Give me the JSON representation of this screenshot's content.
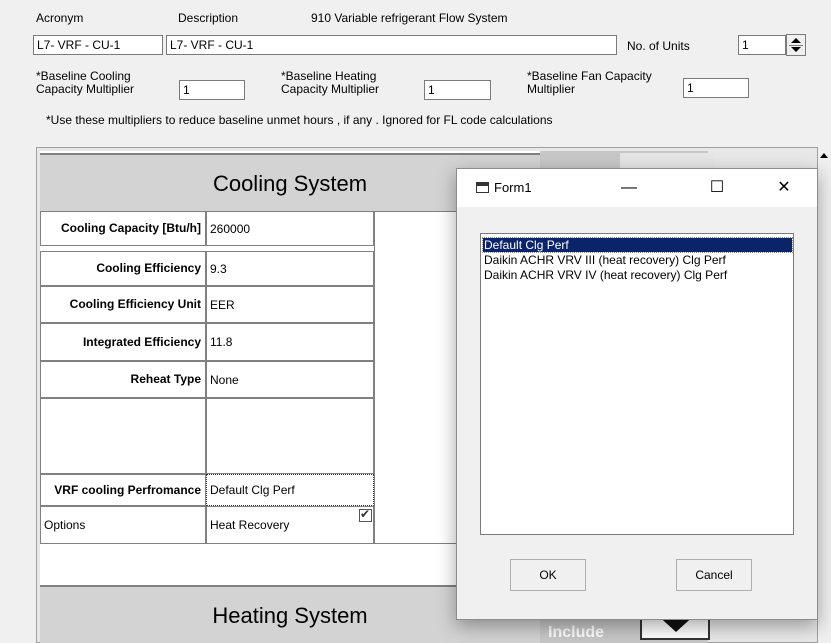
{
  "header": {
    "acronym_label": "Acronym",
    "description_label": "Description",
    "system_type": "910 Variable refrigerant Flow System",
    "acronym_value": "L7- VRF - CU-1",
    "description_value": "L7- VRF - CU-1",
    "units_label": "No. of Units",
    "units_value": "1",
    "cooling_mult_label": "*Baseline Cooling Capacity Multiplier",
    "cooling_mult_value": "1",
    "heating_mult_label": "*Baseline Heating Capacity Multiplier",
    "heating_mult_value": "1",
    "fan_mult_label": "*Baseline Fan Capacity Multiplier",
    "fan_mult_value": "1",
    "note": "*Use these multipliers to reduce baseline unmet hours , if any . Ignored for FL code calculations"
  },
  "cooling": {
    "title": "Cooling System",
    "rows": [
      {
        "label": "Cooling Capacity [Btu/h]",
        "value": "260000"
      },
      {
        "label": "Cooling Efficiency",
        "value": "9.3"
      },
      {
        "label": "Cooling Efficiency Unit",
        "value": "EER"
      },
      {
        "label": "Integrated Efficiency",
        "value": "11.8"
      },
      {
        "label": "Reheat Type",
        "value": "None"
      },
      {
        "label": "",
        "value": ""
      },
      {
        "label": "VRF cooling Perfromance",
        "value": "Default Clg Perf"
      },
      {
        "label": "Options",
        "value": "Heat Recovery"
      }
    ]
  },
  "heating": {
    "title": "Heating System",
    "partial_text": "Include"
  },
  "dialog": {
    "title": "Form1",
    "minimize": "—",
    "maximize": "☐",
    "close": "✕",
    "items": [
      "Default Clg Perf",
      "Daikin ACHR VRV III  (heat recovery) Clg Perf",
      "Daikin ACHR VRV IV (heat recovery) Clg Perf"
    ],
    "selected_index": 0,
    "ok_label": "OK",
    "cancel_label": "Cancel"
  }
}
